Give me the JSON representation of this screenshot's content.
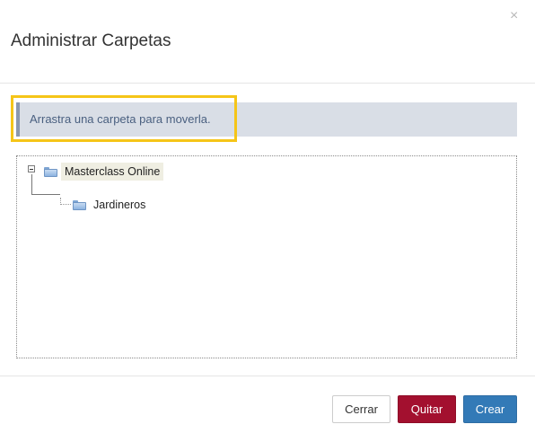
{
  "dialog": {
    "title": "Administrar Carpetas",
    "close_glyph": "×"
  },
  "info": {
    "message": "Arrastra una carpeta para moverla."
  },
  "tree": {
    "root": {
      "label": "Masterclass Online",
      "icon": "folder-icon",
      "expanded": true,
      "selected": true,
      "children": [
        {
          "label": "Jardineros",
          "icon": "folder-icon"
        }
      ]
    }
  },
  "buttons": {
    "close_label": "Cerrar",
    "remove_label": "Quitar",
    "create_label": "Crear"
  },
  "colors": {
    "highlight": "#f5c518",
    "info_bg": "#d9dee6",
    "info_text": "#4a6080",
    "remove_button": "#a3102f",
    "create_button": "#337ab7"
  }
}
